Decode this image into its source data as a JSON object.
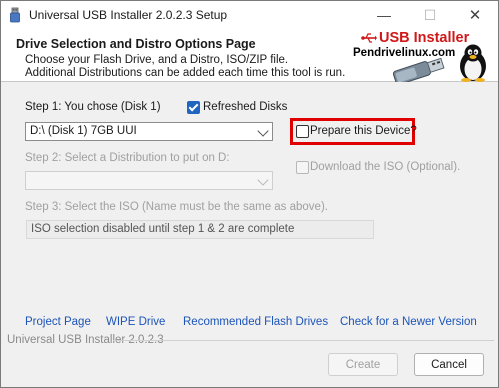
{
  "window": {
    "title": "Universal USB Installer 2.0.2.3 Setup",
    "minimize_glyph": "—",
    "maximize_glyph": "☐",
    "close_glyph": "✕"
  },
  "header": {
    "title": "Drive Selection and Distro Options Page",
    "subtitle_line1": "Choose your Flash Drive, and a Distro, ISO/ZIP file.",
    "subtitle_line2": "Additional Distributions can be added each time this tool is run.",
    "logo_brand": "USB Installer",
    "logo_site": "Pendrivelinux.com"
  },
  "step1": {
    "label": "Step 1: You chose (Disk 1)",
    "refreshed_label": "Refreshed Disks",
    "refreshed_checked": true,
    "drive_value": "D:\\ (Disk 1) 7GB UUI",
    "prepare_label": "Prepare this Device?",
    "prepare_checked": false
  },
  "step2": {
    "label": "Step 2: Select a Distribution to put on D:",
    "distro_value": "",
    "download_label": "Download the ISO (Optional)."
  },
  "step3": {
    "label": "Step 3: Select the ISO (Name must be the same as above).",
    "iso_text": "ISO selection disabled until step 1 & 2 are complete"
  },
  "links": {
    "project": "Project Page",
    "wipe": "WIPE Drive",
    "recommended": "Recommended Flash Drives",
    "newer": "Check for a Newer Version"
  },
  "footer": {
    "version": "Universal USB Installer 2.0.2.3",
    "create": "Create",
    "cancel": "Cancel"
  },
  "colors": {
    "accent": "#1e66c0",
    "link": "#1c54b8",
    "highlight": "#e00000",
    "brand": "#d01818"
  }
}
